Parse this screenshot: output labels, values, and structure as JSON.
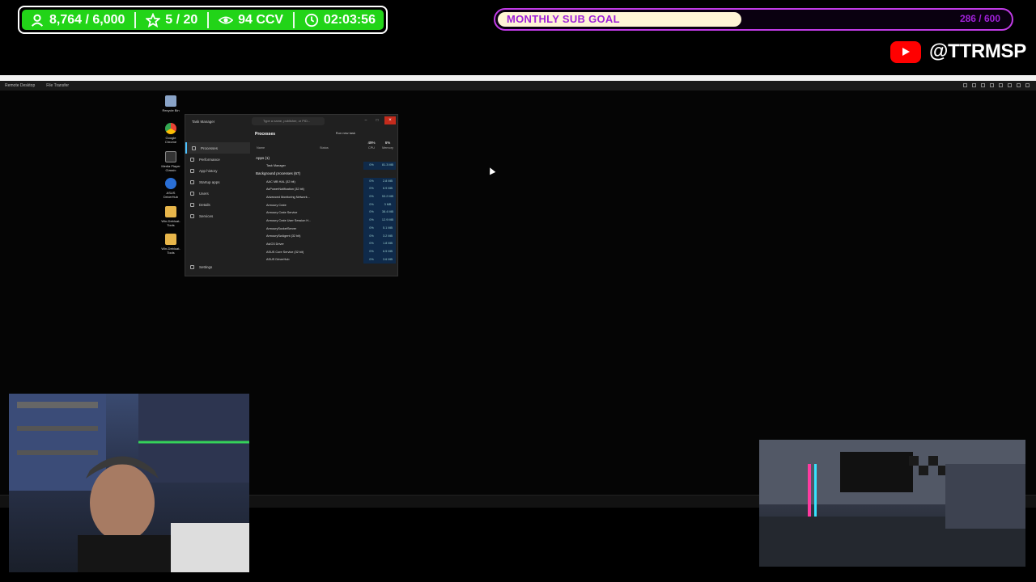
{
  "overlay": {
    "stats": {
      "followers": "8,764 / 6,000",
      "stars": "5 / 20",
      "viewers": "94 CCV",
      "uptime": "02:03:56"
    },
    "sub_goal": {
      "title": "MONTHLY SUB GOAL",
      "count": "286 / 600",
      "progress": 0.477
    },
    "youtube": {
      "handle": "@TTRMSP"
    },
    "colors": {
      "stats_green": "#22d418",
      "goal_purple": "#c13be6",
      "youtube_red": "#ff0000"
    }
  },
  "remote_desktop": {
    "menu": [
      "Remote Desktop",
      "File Transfer"
    ],
    "desktop_icons": [
      "Recycle Bin",
      "Google Chrome",
      "Media Player Classic",
      "ASUS DriverHub",
      "Win-Debloat-Tools",
      "Win-Debloat-Tools"
    ]
  },
  "task_manager": {
    "title": "Task Manager",
    "search_placeholder": "Type a name, publisher, or PID...",
    "section": "Processes",
    "run_new_task": "Run new task",
    "nav": [
      "Processes",
      "Performance",
      "App history",
      "Startup apps",
      "Users",
      "Details",
      "Services"
    ],
    "settings": "Settings",
    "columns": {
      "name": "Name",
      "status": "Status",
      "cpu_pct": "49%",
      "cpu": "CPU",
      "mem_pct": "6%",
      "mem": "Memory"
    },
    "apps_group": "Apps (1)",
    "apps": [
      {
        "name": "Task Manager",
        "cpu": "0%",
        "mem": "81.3 MB"
      }
    ],
    "bg_group": "Background processes (67)",
    "background": [
      {
        "name": "AAC MB HAL (32 bit)",
        "cpu": "0%",
        "mem": "2.8 MB"
      },
      {
        "name": "AcPowerNotification (32 bit)",
        "cpu": "0%",
        "mem": "6.9 MB"
      },
      {
        "name": "Advanced Monitoring Network...",
        "cpu": "0%",
        "mem": "53.2 MB"
      },
      {
        "name": "Armoury Crate",
        "cpu": "0%",
        "mem": "3 MB"
      },
      {
        "name": "Armoury Crate Service",
        "cpu": "0%",
        "mem": "38.4 MB"
      },
      {
        "name": "Armoury Crate User Session H...",
        "cpu": "0%",
        "mem": "12.9 MB"
      },
      {
        "name": "ArmourySocketServer",
        "cpu": "0%",
        "mem": "5.1 MB"
      },
      {
        "name": "ArmourySwAgent (32 bit)",
        "cpu": "0%",
        "mem": "3.2 MB"
      },
      {
        "name": "AsIO3 Driver",
        "cpu": "0%",
        "mem": "1.8 MB"
      },
      {
        "name": "ASUS Core Service (32 bit)",
        "cpu": "0%",
        "mem": "6.5 MB"
      },
      {
        "name": "ASUS DriverHub",
        "cpu": "0%",
        "mem": "3.6 MB"
      }
    ]
  }
}
